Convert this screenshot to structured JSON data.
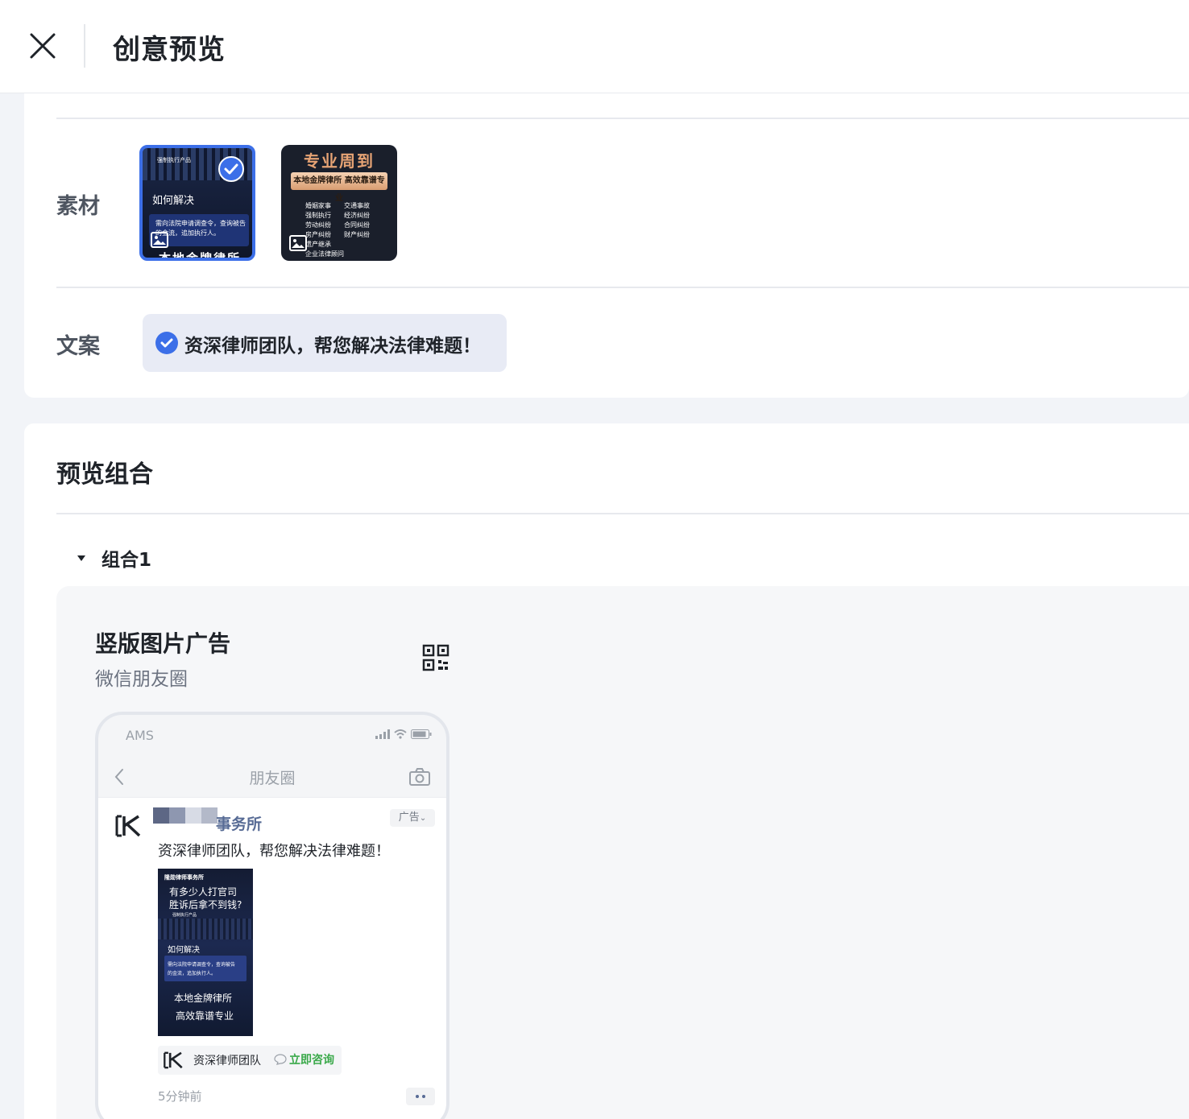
{
  "header": {
    "title": "创意预览",
    "close_icon": "close-icon"
  },
  "materials": {
    "label": "素材",
    "items": [
      {
        "selected": true,
        "texts": [
          "强制执行产品",
          "如何解决",
          "需向法院申请调查令，查询被告的金流，追加执行人。",
          "本地金牌律所"
        ]
      },
      {
        "selected": false,
        "title": "专业周到",
        "band": "本地金牌律所 高效靠谱专业",
        "list": [
          "婚姻家事",
          "交通事故",
          "强制执行",
          "经济纠纷",
          "劳动纠纷",
          "合同纠纷",
          "房产纠纷",
          "财产纠纷",
          "遗产继承",
          "企业法律顾问"
        ]
      }
    ]
  },
  "copy": {
    "label": "文案",
    "selected_text": "资深律师团队，帮您解决法律难题！"
  },
  "preview": {
    "section_title": "预览组合",
    "group_label": "组合1",
    "ad_type": "竖版图片广告",
    "platform": "微信朋友圈",
    "qr_icon": "qr-code-icon"
  },
  "phone": {
    "carrier": "AMS",
    "nav_title": "朋友圈",
    "account_name": "事务所",
    "ad_tag": "广告",
    "post_text": "资深律师团队，帮您解决法律难题！",
    "image_texts": {
      "brand": "隆勋律师事务所",
      "headline1": "有多少人打官司",
      "headline2": "胜诉后拿不到钱?",
      "sub": "强制执行产品",
      "how": "如何解决",
      "box1": "需向法院申请调查令，查询被告",
      "box2": "的金流，追加执行人。",
      "bottom1": "本地金牌律所",
      "bottom2": "高效靠谱专业"
    },
    "cta_brand": "资深律师团队",
    "cta_button": "立即咨询",
    "time_ago": "5分钟前"
  },
  "colors": {
    "accent": "#3c6fe8",
    "link": "#576b95",
    "cta": "#3aa94a"
  }
}
